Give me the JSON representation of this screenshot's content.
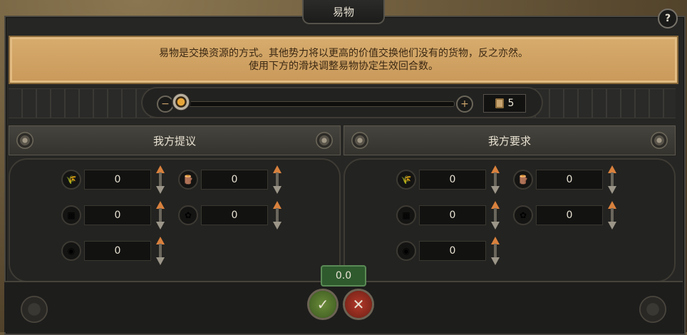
{
  "window": {
    "title": "易物",
    "help_label": "?"
  },
  "info": {
    "line1": "易物是交换资源的方式。其他势力将以更高的价值交换他们没有的货物，反之亦然。",
    "line2": "使用下方的滑块调整易物协定生效回合数。"
  },
  "slider": {
    "minus_label": "−",
    "plus_label": "+",
    "turns": "5",
    "turns_fraction": 0.0
  },
  "offer": {
    "title": "我方提议",
    "items": [
      {
        "icon": "wheat-icon",
        "glyph": "🌾",
        "value": "0"
      },
      {
        "icon": "wood-icon",
        "glyph": "🪵",
        "value": "0"
      },
      {
        "icon": "stone-icon",
        "glyph": "▦",
        "value": "0"
      },
      {
        "icon": "cloth-icon",
        "glyph": "✿",
        "value": "0"
      },
      {
        "icon": "gold-icon",
        "glyph": "◉",
        "value": "0"
      }
    ]
  },
  "request": {
    "title": "我方要求",
    "items": [
      {
        "icon": "wheat-icon",
        "glyph": "🌾",
        "value": "0"
      },
      {
        "icon": "wood-icon",
        "glyph": "🪵",
        "value": "0"
      },
      {
        "icon": "stone-icon",
        "glyph": "▦",
        "value": "0"
      },
      {
        "icon": "cloth-icon",
        "glyph": "✿",
        "value": "0"
      },
      {
        "icon": "gold-icon",
        "glyph": "◉",
        "value": "0"
      }
    ]
  },
  "balance": "0.0",
  "actions": {
    "accept_glyph": "✓",
    "decline_glyph": "✕"
  },
  "colors": {
    "parchment": "#d0a363",
    "accept": "#4d6e28",
    "decline": "#8e281c",
    "balance": "#2e5a2e"
  }
}
